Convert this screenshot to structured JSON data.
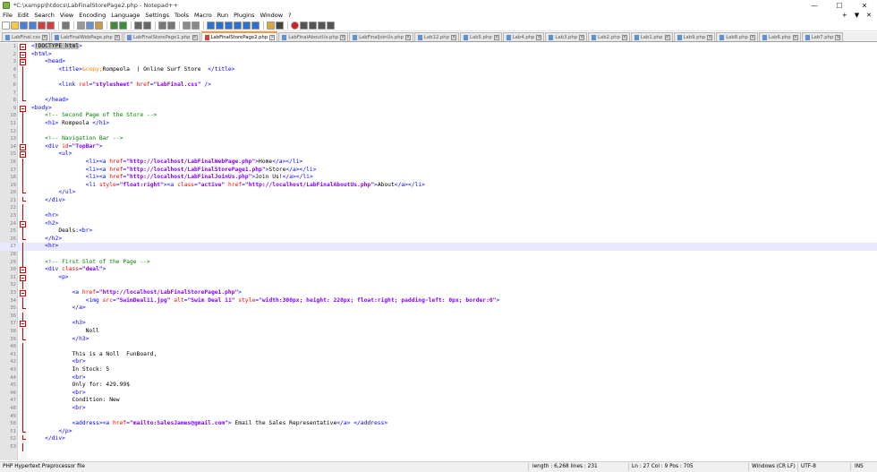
{
  "window": {
    "title": "*C:\\xampp\\htdocs\\LabFinalStorePage2.php - Notepad++",
    "minimize": "—",
    "maximize": "☐",
    "close": "✕"
  },
  "menu": {
    "items": [
      "File",
      "Edit",
      "Search",
      "View",
      "Encoding",
      "Language",
      "Settings",
      "Tools",
      "Macro",
      "Run",
      "Plugins",
      "Window",
      "?"
    ],
    "right": [
      "+",
      "▼",
      "✕"
    ]
  },
  "toolbar": {
    "icons": [
      "new-icon",
      "open-icon",
      "save-icon",
      "save-all-icon",
      "close-icon",
      "close-all-icon",
      "print-icon",
      "cut-icon",
      "copy-icon",
      "paste-icon",
      "undo-icon",
      "redo-icon",
      "find-icon",
      "replace-icon",
      "zoom-in-icon",
      "zoom-out-icon",
      "sync-v-icon",
      "sync-h-icon",
      "wrap-icon",
      "all-chars-icon",
      "indent-guide-icon",
      "udl-icon",
      "doc-map-icon",
      "func-list-icon",
      "folder-workspace-icon",
      "monitor-icon",
      "record-icon",
      "stop-icon",
      "play-icon",
      "play-multi-icon",
      "save-macro-icon"
    ]
  },
  "tabs": [
    {
      "label": "LabFinal.css",
      "active": false
    },
    {
      "label": "LabFinalWebPage.php",
      "active": false
    },
    {
      "label": "LabFinalStorePage1.php",
      "active": false
    },
    {
      "label": "LabFinalStorePage2.php",
      "active": true
    },
    {
      "label": "LabFinalAboutUs.php",
      "active": false
    },
    {
      "label": "LabFinalJoinUs.php",
      "active": false
    },
    {
      "label": "Lab12.php",
      "active": false
    },
    {
      "label": "Lab5.php",
      "active": false
    },
    {
      "label": "Lab4.php",
      "active": false
    },
    {
      "label": "Lab3.php",
      "active": false
    },
    {
      "label": "Lab2.php",
      "active": false
    },
    {
      "label": "Lab1.php",
      "active": false
    },
    {
      "label": "Lab9.php",
      "active": false
    },
    {
      "label": "Lab8.php",
      "active": false
    },
    {
      "label": "Lab6.php",
      "active": false
    },
    {
      "label": "Lab7.php",
      "active": false
    }
  ],
  "current_line": 27,
  "lines": [
    {
      "n": "1",
      "fold": "box",
      "tokens": [
        [
          "tg",
          "<"
        ],
        [
          "hl",
          "!DOCTYPE html"
        ],
        [
          "tg",
          ">"
        ]
      ]
    },
    {
      "n": "2",
      "fold": "box",
      "tokens": [
        [
          "tg",
          "<html>"
        ]
      ]
    },
    {
      "n": "3",
      "fold": "box",
      "tokens": [
        [
          "tx",
          "    "
        ],
        [
          "tg",
          "<head>"
        ]
      ]
    },
    {
      "n": "4",
      "fold": "vl",
      "tokens": [
        [
          "tx",
          "        "
        ],
        [
          "tg",
          "<title>"
        ],
        [
          "en",
          "&copy;"
        ],
        [
          "tx",
          "Rompeola  | Online Surf Store  "
        ],
        [
          "tg",
          "</title>"
        ]
      ]
    },
    {
      "n": "5",
      "fold": "vl",
      "tokens": []
    },
    {
      "n": "6",
      "fold": "vl",
      "tokens": [
        [
          "tx",
          "        "
        ],
        [
          "tg",
          "<link "
        ],
        [
          "at",
          "rel"
        ],
        [
          "tg",
          "="
        ],
        [
          "vl2",
          "\"stylesheet\""
        ],
        [
          "tg",
          " "
        ],
        [
          "at",
          "href"
        ],
        [
          "tg",
          "="
        ],
        [
          "vl2",
          "\"LabFinal.css\""
        ],
        [
          "tg",
          " />"
        ]
      ]
    },
    {
      "n": "7",
      "fold": "vl",
      "tokens": []
    },
    {
      "n": "8",
      "fold": "end",
      "tokens": [
        [
          "tx",
          "    "
        ],
        [
          "tg",
          "</head>"
        ]
      ]
    },
    {
      "n": "9",
      "fold": "box",
      "tokens": [
        [
          "tg",
          "<body>"
        ]
      ]
    },
    {
      "n": "10",
      "fold": "vl",
      "tokens": [
        [
          "tx",
          "    "
        ],
        [
          "cm",
          "<!-- Second Page of the Store -->"
        ]
      ]
    },
    {
      "n": "11",
      "fold": "vl",
      "tokens": [
        [
          "tx",
          "    "
        ],
        [
          "tg",
          "<h1>"
        ],
        [
          "tx",
          " Rompeola "
        ],
        [
          "tg",
          "</h1>"
        ]
      ]
    },
    {
      "n": "12",
      "fold": "vl",
      "tokens": []
    },
    {
      "n": "13",
      "fold": "vl",
      "tokens": [
        [
          "tx",
          "    "
        ],
        [
          "cm",
          "<!-- Navigation Bar -->"
        ]
      ]
    },
    {
      "n": "14",
      "fold": "box",
      "tokens": [
        [
          "tx",
          "    "
        ],
        [
          "tg",
          "<div "
        ],
        [
          "at",
          "id"
        ],
        [
          "tg",
          "="
        ],
        [
          "vl2",
          "\"TopBar\""
        ],
        [
          "tg",
          ">"
        ]
      ]
    },
    {
      "n": "15",
      "fold": "box",
      "tokens": [
        [
          "tx",
          "        "
        ],
        [
          "tg",
          "<ul>"
        ]
      ]
    },
    {
      "n": "16",
      "fold": "vl",
      "tokens": [
        [
          "tx",
          "                "
        ],
        [
          "tg",
          "<li><a "
        ],
        [
          "at",
          "href"
        ],
        [
          "tg",
          "="
        ],
        [
          "vl2",
          "\"http://localhost/LabFinalWebPage.php\""
        ],
        [
          "tg",
          ">"
        ],
        [
          "tx",
          "Home"
        ],
        [
          "tg",
          "</a></li>"
        ]
      ]
    },
    {
      "n": "17",
      "fold": "vl",
      "tokens": [
        [
          "tx",
          "                "
        ],
        [
          "tg",
          "<li><a "
        ],
        [
          "at",
          "href"
        ],
        [
          "tg",
          "="
        ],
        [
          "vl2",
          "\"http://localhost/LabFinalStorePage1.php\""
        ],
        [
          "tg",
          ">"
        ],
        [
          "tx",
          "Store"
        ],
        [
          "tg",
          "</a></li>"
        ]
      ]
    },
    {
      "n": "18",
      "fold": "vl",
      "tokens": [
        [
          "tx",
          "                "
        ],
        [
          "tg",
          "<li><a "
        ],
        [
          "at",
          "href"
        ],
        [
          "tg",
          "="
        ],
        [
          "vl2",
          "\"http://localhost/LabFinalJoinUs.php\""
        ],
        [
          "tg",
          ">"
        ],
        [
          "tx",
          "Join Us!"
        ],
        [
          "tg",
          "</a></li>"
        ]
      ]
    },
    {
      "n": "19",
      "fold": "vl",
      "tokens": [
        [
          "tx",
          "                "
        ],
        [
          "tg",
          "<li "
        ],
        [
          "at",
          "style"
        ],
        [
          "tg",
          "="
        ],
        [
          "vl2",
          "\"float:right\""
        ],
        [
          "tg",
          "><a "
        ],
        [
          "at",
          "class"
        ],
        [
          "tg",
          "="
        ],
        [
          "vl2",
          "\"active\""
        ],
        [
          "tg",
          " "
        ],
        [
          "at",
          "href"
        ],
        [
          "tg",
          "="
        ],
        [
          "vl2",
          "\"http://localhost/LabFinalAboutUs.php\""
        ],
        [
          "tg",
          ">"
        ],
        [
          "tx",
          "About"
        ],
        [
          "tg",
          "</a></li>"
        ]
      ]
    },
    {
      "n": "20",
      "fold": "end",
      "tokens": [
        [
          "tx",
          "        "
        ],
        [
          "tg",
          "</ul>"
        ]
      ]
    },
    {
      "n": "21",
      "fold": "end",
      "tokens": [
        [
          "tx",
          "    "
        ],
        [
          "tg",
          "</div>"
        ]
      ]
    },
    {
      "n": "22",
      "fold": "vl",
      "tokens": []
    },
    {
      "n": "23",
      "fold": "vl",
      "tokens": [
        [
          "tx",
          "    "
        ],
        [
          "tg",
          "<hr>"
        ]
      ]
    },
    {
      "n": "24",
      "fold": "box",
      "tokens": [
        [
          "tx",
          "    "
        ],
        [
          "tg",
          "<h2>"
        ]
      ]
    },
    {
      "n": "25",
      "fold": "vl",
      "tokens": [
        [
          "tx",
          "        Deals:"
        ],
        [
          "tg",
          "<br>"
        ]
      ]
    },
    {
      "n": "26",
      "fold": "end",
      "tokens": [
        [
          "tx",
          "    "
        ],
        [
          "tg",
          "</h2>"
        ]
      ]
    },
    {
      "n": "27",
      "fold": "vl",
      "tokens": [
        [
          "tx",
          "    "
        ],
        [
          "tg",
          "<hr>"
        ]
      ]
    },
    {
      "n": "28",
      "fold": "vl",
      "tokens": []
    },
    {
      "n": "29",
      "fold": "vl",
      "tokens": [
        [
          "tx",
          "    "
        ],
        [
          "cm",
          "<!-- First Slot of the Page -->"
        ]
      ]
    },
    {
      "n": "30",
      "fold": "box",
      "tokens": [
        [
          "tx",
          "    "
        ],
        [
          "tg",
          "<div "
        ],
        [
          "at",
          "class"
        ],
        [
          "tg",
          "="
        ],
        [
          "vl2",
          "\"deal\""
        ],
        [
          "tg",
          ">"
        ]
      ]
    },
    {
      "n": "31",
      "fold": "box",
      "tokens": [
        [
          "tx",
          "        "
        ],
        [
          "tg",
          "<p>"
        ]
      ]
    },
    {
      "n": "32",
      "fold": "vl",
      "tokens": []
    },
    {
      "n": "33",
      "fold": "box",
      "tokens": [
        [
          "tx",
          "            "
        ],
        [
          "tg",
          "<a "
        ],
        [
          "at",
          "href"
        ],
        [
          "tg",
          "="
        ],
        [
          "vl2",
          "\"http://localhost/LabFinalStorePage1.php\""
        ],
        [
          "tg",
          ">"
        ]
      ]
    },
    {
      "n": "34",
      "fold": "vl",
      "tokens": [
        [
          "tx",
          "                "
        ],
        [
          "tg",
          "<img "
        ],
        [
          "at",
          "src"
        ],
        [
          "tg",
          "="
        ],
        [
          "vl2",
          "\"SwimDeal11.jpg\""
        ],
        [
          "tg",
          " "
        ],
        [
          "at",
          "alt"
        ],
        [
          "tg",
          "="
        ],
        [
          "vl2",
          "\"Swim Deal 11\""
        ],
        [
          "tg",
          " "
        ],
        [
          "at",
          "style"
        ],
        [
          "tg",
          "="
        ],
        [
          "vl2",
          "\"width:300px; height: 220px; float:right; padding-left: 0px; border:0\""
        ],
        [
          "tg",
          ">"
        ]
      ]
    },
    {
      "n": "35",
      "fold": "end",
      "tokens": [
        [
          "tx",
          "            "
        ],
        [
          "tg",
          "</a>"
        ]
      ]
    },
    {
      "n": "36",
      "fold": "vl",
      "tokens": []
    },
    {
      "n": "37",
      "fold": "box",
      "tokens": [
        [
          "tx",
          "            "
        ],
        [
          "tg",
          "<h3>"
        ]
      ]
    },
    {
      "n": "38",
      "fold": "vl",
      "tokens": [
        [
          "tx",
          "                Noll"
        ]
      ]
    },
    {
      "n": "39",
      "fold": "end",
      "tokens": [
        [
          "tx",
          "            "
        ],
        [
          "tg",
          "</h3>"
        ]
      ]
    },
    {
      "n": "40",
      "fold": "vl",
      "tokens": []
    },
    {
      "n": "41",
      "fold": "vl",
      "tokens": [
        [
          "tx",
          "            This is a Noll  FunBoard,"
        ]
      ]
    },
    {
      "n": "42",
      "fold": "vl",
      "tokens": [
        [
          "tx",
          "            "
        ],
        [
          "tg",
          "<br>"
        ]
      ]
    },
    {
      "n": "43",
      "fold": "vl",
      "tokens": [
        [
          "tx",
          "            In Stock: 5"
        ]
      ]
    },
    {
      "n": "44",
      "fold": "vl",
      "tokens": [
        [
          "tx",
          "            "
        ],
        [
          "tg",
          "<br>"
        ]
      ]
    },
    {
      "n": "45",
      "fold": "vl",
      "tokens": [
        [
          "tx",
          "            Only for: 429.99$"
        ]
      ]
    },
    {
      "n": "46",
      "fold": "vl",
      "tokens": [
        [
          "tx",
          "            "
        ],
        [
          "tg",
          "<br>"
        ]
      ]
    },
    {
      "n": "47",
      "fold": "vl",
      "tokens": [
        [
          "tx",
          "            Condition: New"
        ]
      ]
    },
    {
      "n": "48",
      "fold": "vl",
      "tokens": [
        [
          "tx",
          "            "
        ],
        [
          "tg",
          "<br>"
        ]
      ]
    },
    {
      "n": "49",
      "fold": "vl",
      "tokens": []
    },
    {
      "n": "50",
      "fold": "vl",
      "tokens": [
        [
          "tx",
          "            "
        ],
        [
          "tg",
          "<address><a "
        ],
        [
          "at",
          "href"
        ],
        [
          "tg",
          "="
        ],
        [
          "vl2",
          "\"mailto:SalesJames@gmail.com\""
        ],
        [
          "tg",
          ">"
        ],
        [
          "tx",
          " Email the Sales Representative"
        ],
        [
          "tg",
          "</a> </address>"
        ]
      ]
    },
    {
      "n": "51",
      "fold": "end",
      "tokens": [
        [
          "tx",
          "        "
        ],
        [
          "tg",
          "</p>"
        ]
      ]
    },
    {
      "n": "52",
      "fold": "end",
      "tokens": [
        [
          "tx",
          "    "
        ],
        [
          "tg",
          "</div>"
        ]
      ]
    },
    {
      "n": "53",
      "fold": "vl",
      "tokens": []
    }
  ],
  "status": {
    "language": "PHP Hypertext Preprocessor file",
    "length": "length : 6,268    lines : 231",
    "position": "Ln : 27    Col : 9    Pos : 705",
    "eol": "Windows (CR LF)",
    "encoding": "UTF-8",
    "mode": "INS"
  }
}
